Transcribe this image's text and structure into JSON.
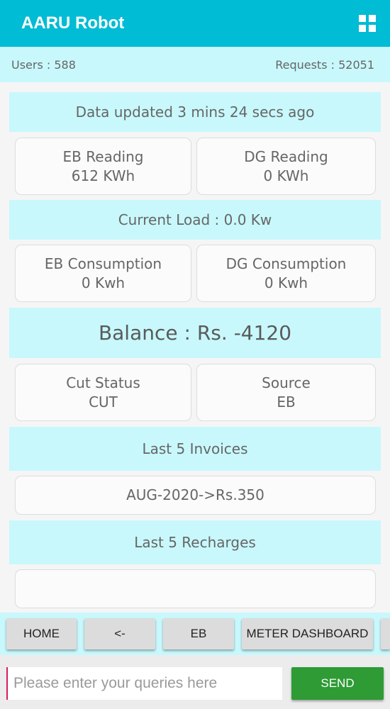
{
  "app": {
    "title": "AARU Robot",
    "menu_icon": "grid-icon"
  },
  "stats": {
    "users": "Users : 588",
    "requests": "Requests : 52051"
  },
  "updated": "Data updated 3 mins 24 secs  ago",
  "eb_reading": {
    "label": "EB Reading",
    "value": "612 KWh"
  },
  "dg_reading": {
    "label": "DG Reading",
    "value": "0 KWh"
  },
  "current_load": "Current Load : 0.0 Kw",
  "eb_consumption": {
    "label": "EB Consumption",
    "value": "0 Kwh"
  },
  "dg_consumption": {
    "label": "DG Consumption",
    "value": "0 Kwh"
  },
  "balance": "Balance : Rs. -4120",
  "cut_status": {
    "label": "Cut Status",
    "value": "CUT"
  },
  "source": {
    "label": "Source",
    "value": "EB"
  },
  "invoices": {
    "title": "Last 5 Invoices",
    "items": [
      "AUG-2020->Rs.350"
    ]
  },
  "recharges": {
    "title": "Last 5 Recharges",
    "items": [
      ""
    ]
  },
  "nav": {
    "home": "HOME",
    "back": "<-",
    "eb": "EB",
    "meter_dashboard": "METER DASHBOARD"
  },
  "query": {
    "placeholder": "Please enter your queries here",
    "value": ""
  },
  "send_label": "SEND",
  "colors": {
    "accent": "#00bcd4",
    "panel": "#c8f8fc",
    "send": "#2e9b35"
  }
}
